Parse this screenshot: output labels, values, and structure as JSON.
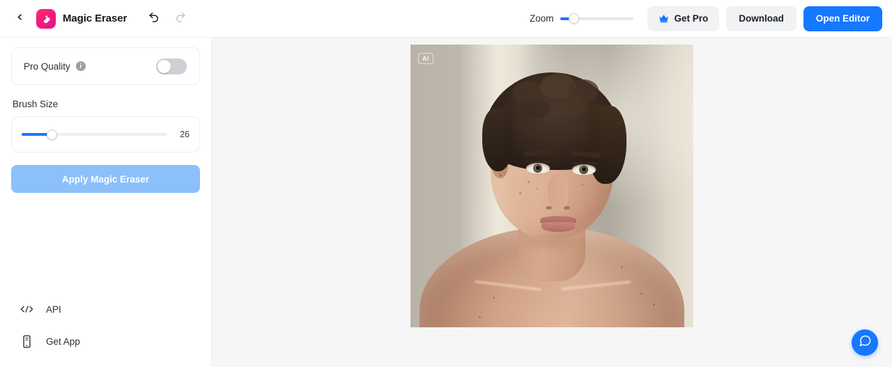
{
  "header": {
    "back_icon": "chevron-left-icon",
    "logo_icon": "magic-eraser-logo-icon",
    "app_title": "Magic Eraser",
    "undo_icon": "undo-icon",
    "redo_icon": "redo-icon",
    "zoom_label": "Zoom",
    "zoom_value": 12,
    "zoom_min": 0,
    "zoom_max": 100,
    "get_pro_label": "Get Pro",
    "get_pro_icon": "crown-icon",
    "download_label": "Download",
    "open_editor_label": "Open Editor"
  },
  "sidebar": {
    "pro_quality": {
      "label": "Pro Quality",
      "info_icon": "info-icon",
      "info_glyph": "i",
      "enabled": false
    },
    "brush": {
      "section_label": "Brush Size",
      "value": "26",
      "min": 1,
      "max": 100
    },
    "apply_label": "Apply Magic Eraser",
    "links": [
      {
        "label": "API",
        "icon": "code-icon",
        "glyph": "</>"
      },
      {
        "label": "Get App",
        "icon": "mobile-phone-icon"
      }
    ]
  },
  "canvas": {
    "ai_badge": "AI",
    "image_alt": "portrait-photo"
  },
  "help": {
    "icon": "chat-bubble-icon"
  },
  "colors": {
    "accent_blue": "#1677ff",
    "accent_blue_muted": "#8cc0fb",
    "brand_pink": "#f2197c",
    "neutral_button": "#f1f2f4",
    "canvas_bg": "#f6f6f7",
    "toggle_off": "#cdd0d4"
  }
}
